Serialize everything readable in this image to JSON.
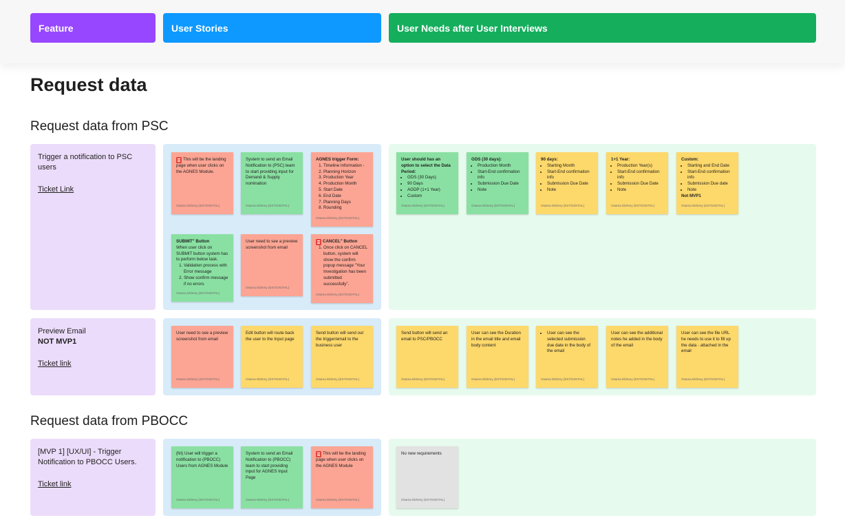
{
  "headers": {
    "feature": {
      "label": "Feature",
      "color": "#9747ff"
    },
    "user_stories": {
      "label": "User Stories",
      "color": "#0d99ff"
    },
    "user_needs": {
      "label": "User Needs after User Interviews",
      "color": "#14ae5c"
    }
  },
  "page_title": "Request data",
  "sections": [
    {
      "title": "Request data from PSC",
      "rows": [
        {
          "feature": {
            "title": "Trigger a notification to PSC users",
            "link": "Ticket Link"
          },
          "stories": [
            {
              "color": "red",
              "icon": "doc-icon",
              "text": "This will be the landing page when user clicks on the AGNES Module.",
              "author": "Osama Eldreny (EXT:DIGITAL)"
            },
            {
              "color": "green",
              "text": "System to send an Email Notification to (PSC) team to start providing input for Demand & Supply nomination",
              "author": "Osama Eldreny (EXT:DIGITAL)"
            },
            {
              "color": "red",
              "title": "AGNES trigger Form:",
              "items": [
                "Timeline Information -",
                "Planning Horizon",
                "Production Year",
                "Production Month",
                "Start Date",
                "End Date",
                "Planning Days",
                "Rounding"
              ],
              "author": "Osama Eldreny (EXT:DIGITAL)"
            },
            {
              "color": "green",
              "title": "SUBMIT\" Button",
              "text": "When user click on SUBMIT button system has to perform below task.",
              "items": [
                "Validation process with Error message",
                "Show confirm message if no errors"
              ],
              "author": "Osama Eldreny (EXT:DIGITAL)"
            },
            {
              "color": "red",
              "text": "User need to see a preview screenshot from email",
              "author": "Osama Eldreny (EXT:DIGITAL)"
            },
            {
              "color": "red",
              "icon": "doc-icon",
              "title": "CANCEL\" Button",
              "items": [
                "Once click on CANCEL button, system will show the confirm popup message \"Your Investigation has been submitted successfully\"."
              ],
              "author": "Osama Eldreny (EXT:DIGITAL)"
            }
          ],
          "needs": [
            {
              "color": "green",
              "title": "User should has an option to select the Data Period:",
              "items": [
                "GDS (30 Days)",
                "90 Days",
                "AGDP (1+1 Year)",
                "Custom"
              ],
              "author": "Osama Eldreny (EXT:DIGITAL)"
            },
            {
              "color": "green",
              "title": "GDS (30 days):",
              "items": [
                "Production Month",
                "Start-End confirmation info",
                "Submission Due Date",
                "Note"
              ],
              "author": "Osama Eldreny (EXT:DIGITAL)"
            },
            {
              "color": "yellow",
              "title": "90 days:",
              "items": [
                "Starting Month",
                "Start-End confirmation info",
                "Submission Due Date",
                "Note"
              ],
              "author": "Osama Eldreny (EXT:DIGITAL)"
            },
            {
              "color": "yellow",
              "title": "1+1 Year:",
              "items": [
                "Production Year(s)",
                "Start-End confirmation info",
                "Submission Due Date",
                "Note"
              ],
              "author": "Osama Eldreny (EXT:DIGITAL)"
            },
            {
              "color": "yellow",
              "title": "Custom:",
              "items": [
                "Starting and End Date",
                "Start-End confirmation info",
                "Submission Due date",
                "Note"
              ],
              "footer": "Not MVP1",
              "author": "Osama Eldreny (EXT:DIGITAL)"
            }
          ]
        },
        {
          "feature": {
            "title": "Preview Email",
            "subtitle": "NOT MVP1",
            "link": "Ticket link"
          },
          "stories": [
            {
              "color": "red",
              "text": "User need to see a preview screenshot from email",
              "author": "Osama Eldreny (EXT:DIGITAL)"
            },
            {
              "color": "yellow",
              "text": "Edit button will route back the user to the Input page",
              "author": "Osama Eldreny (EXT:DIGITAL)"
            },
            {
              "color": "yellow",
              "text": "Send button will send out the trigger/email to the business user",
              "author": "Osama Eldreny (EXT:DIGITAL)"
            }
          ],
          "needs": [
            {
              "color": "yellow",
              "text": "Send button will send an email to PSC/PBOCC",
              "author": "Osama Eldreny (EXT:DIGITAL)"
            },
            {
              "color": "yellow",
              "text": "User can see the Duration in the email title and email body content",
              "author": "Osama Eldreny (EXT:DIGITAL)"
            },
            {
              "color": "yellow",
              "items": [
                "User can see the selected submission due date in the body of the email"
              ],
              "author": "Osama Eldreny (EXT:DIGITAL)"
            },
            {
              "color": "yellow",
              "text": "User can see the additional notes he added in the body of the email",
              "author": "Osama Eldreny (EXT:DIGITAL)"
            },
            {
              "color": "yellow",
              "text": "User can see the file URL he needs to use it to fill up the data - attached in the email",
              "author": "Osama Eldreny (EXT:DIGITAL)"
            }
          ]
        }
      ]
    },
    {
      "title": "Request data from PBOCC",
      "rows": [
        {
          "feature": {
            "title": "[MVP 1] [UX/UI] - Trigger Notification to PBOCC Users.",
            "link": "Ticket link"
          },
          "stories": [
            {
              "color": "green",
              "text": "(NI) User will trigger a notification to (PBOCC) Users from AGNES Module",
              "author": "Osama Eldreny (EXT:DIGITAL)"
            },
            {
              "color": "green",
              "text": "System to send an Email Notification to (PBOCC) team to start providing input for AGNES Input Page",
              "author": "Osama Eldreny (EXT:DIGITAL)"
            },
            {
              "color": "red",
              "icon": "doc-icon",
              "text": "This will be the landing page when user clicks on the AGNES Module",
              "author": "Osama Eldreny (EXT:DIGITAL)"
            }
          ],
          "needs": [
            {
              "color": "grey",
              "text": "No new requirements",
              "author": "Osama Eldreny (EXT:DIGITAL)"
            }
          ]
        }
      ]
    }
  ]
}
